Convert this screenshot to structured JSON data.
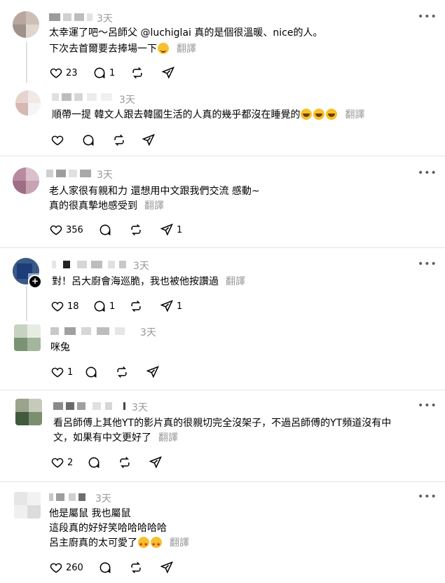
{
  "translate_label": "翻譯",
  "more_label": "•••",
  "posts": [
    {
      "time": "3天",
      "lines": [
        "太幸運了吧～呂師父 @luchiglai 真的是個很溫暖、nice的人。",
        "下次去首爾要去捧場一下"
      ],
      "likes": "23",
      "replies": "1",
      "reposts": "",
      "shares": ""
    },
    {
      "time": "3天",
      "lines": [
        "順帶一提 韓文人跟去韓國生活的人真的幾乎都沒在睡覺的"
      ],
      "likes": "",
      "replies": "",
      "reposts": "",
      "shares": ""
    },
    {
      "time": "3天",
      "lines": [
        "老人家很有親和力 還想用中文跟我們交流 感動~",
        "真的很真摯地感受到"
      ],
      "likes": "356",
      "replies": "",
      "reposts": "",
      "shares": "1"
    },
    {
      "time": "3天",
      "lines": [
        "對！呂大廚會海巡脆，我也被他按讚過"
      ],
      "likes": "18",
      "replies": "1",
      "reposts": "",
      "shares": "1"
    },
    {
      "time": "3天",
      "lines": [
        "咪兔"
      ],
      "likes": "1",
      "replies": "",
      "reposts": "",
      "shares": ""
    },
    {
      "time": "3天",
      "lines": [
        "看呂師傅上其他YT的影片真的很親切完全沒架子，不過呂師傅的YT頻道沒有中",
        "文，如果有中文更好了"
      ],
      "likes": "2",
      "replies": "",
      "reposts": "",
      "shares": ""
    },
    {
      "time": "3天",
      "lines": [
        "他是屬鼠 我也屬鼠",
        "這段真的好好笑哈哈哈哈哈",
        "呂主廚真的太可愛了"
      ],
      "likes": "260",
      "replies": "",
      "reposts": "",
      "shares": ""
    }
  ],
  "colors": {
    "text": "#000000",
    "muted": "#999999",
    "divider": "#e5e5e5",
    "emoji": "#f7c02c"
  },
  "icons": [
    "heart-icon",
    "comment-icon",
    "repost-icon",
    "share-icon",
    "more-icon",
    "plus-icon"
  ]
}
